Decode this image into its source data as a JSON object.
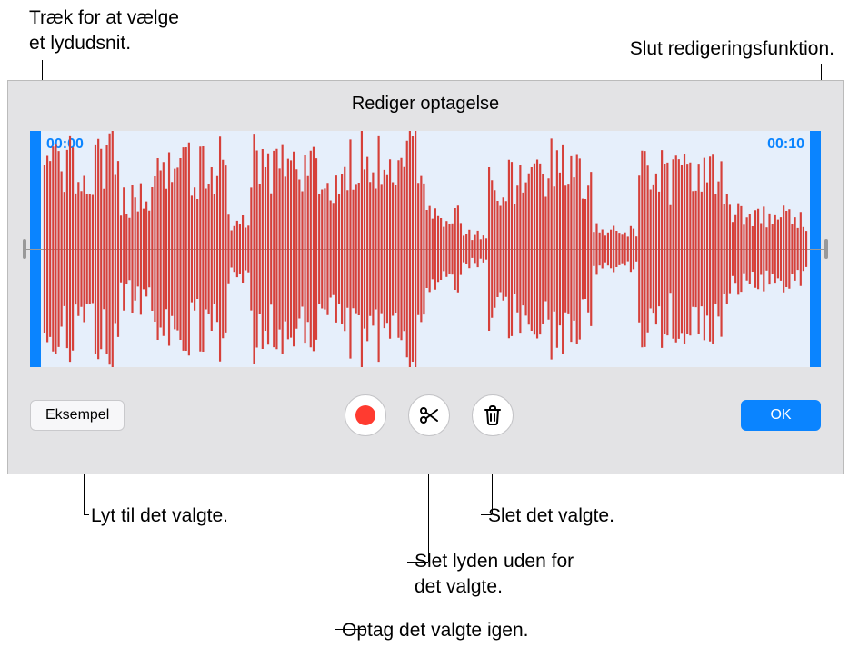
{
  "annotations": {
    "drag": "Træk for at vælge\net lydudsnit.",
    "end": "Slut redigeringsfunktion.",
    "listen": "Lyt til det valgte.",
    "delete": "Slet det valgte.",
    "trim": "Slet lyden uden for\ndet valgte.",
    "rerec": "Optag det valgte igen."
  },
  "panel": {
    "title": "Rediger optagelse",
    "time_start": "00:00",
    "time_end": "00:10"
  },
  "toolbar": {
    "preview_label": "Eksempel",
    "ok_label": "OK"
  },
  "colors": {
    "accent": "#0a84ff",
    "record": "#ff3b30",
    "wave": "#d6403a"
  }
}
